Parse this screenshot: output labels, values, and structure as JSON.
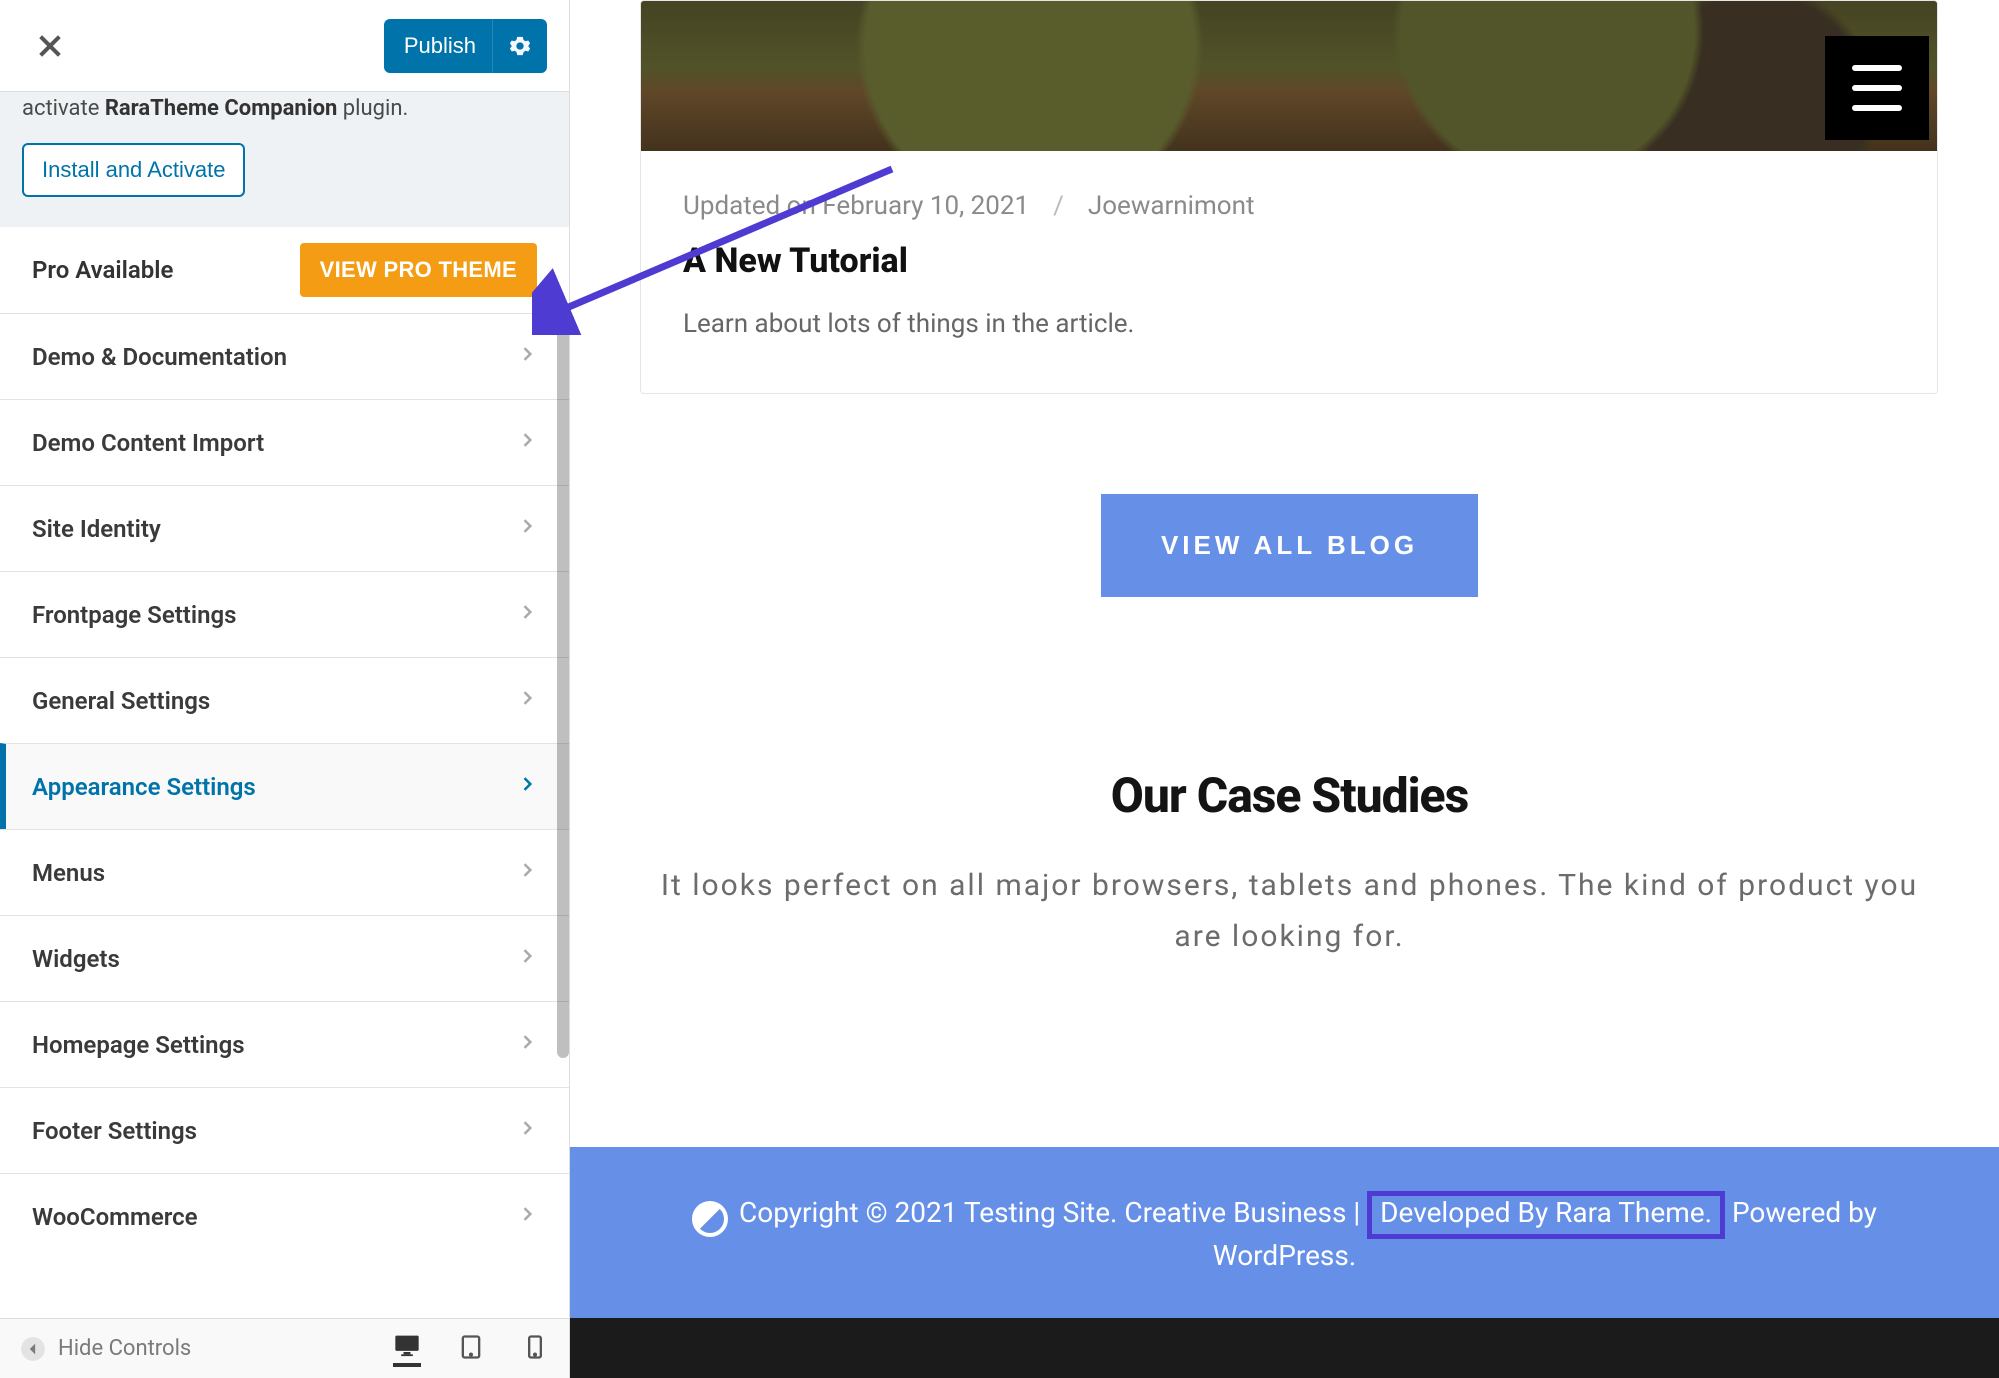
{
  "customizer": {
    "publish_label": "Publish",
    "notice_html_prefix": "activate ",
    "notice_bold": "RaraTheme Companion",
    "notice_html_suffix": " plugin.",
    "install_btn": "Install and Activate",
    "hide_controls": "Hide Controls"
  },
  "panels": {
    "pro_label": "Pro Available",
    "pro_btn": "VIEW PRO THEME",
    "items": [
      "Demo & Documentation",
      "Demo Content Import",
      "Site Identity",
      "Frontpage Settings",
      "General Settings",
      "Appearance Settings",
      "Menus",
      "Widgets",
      "Homepage Settings",
      "Footer Settings",
      "WooCommerce"
    ],
    "active_index": 5
  },
  "preview": {
    "meta_updated": "Updated on February 10, 2021",
    "meta_author": "Joewarnimont",
    "card_title": "A New Tutorial",
    "card_desc": "Learn about lots of things in the article.",
    "view_all": "VIEW ALL BLOG",
    "case_title": "Our Case Studies",
    "case_sub": "It looks perfect on all major browsers, tablets and phones. The kind of product you are looking for."
  },
  "footer": {
    "left": "Copyright © 2021 Testing Site. Creative Business ",
    "pipe": " | ",
    "dev": "Developed By Rara Theme.",
    "right1": " Powered by ",
    "right2": "WordPress."
  }
}
